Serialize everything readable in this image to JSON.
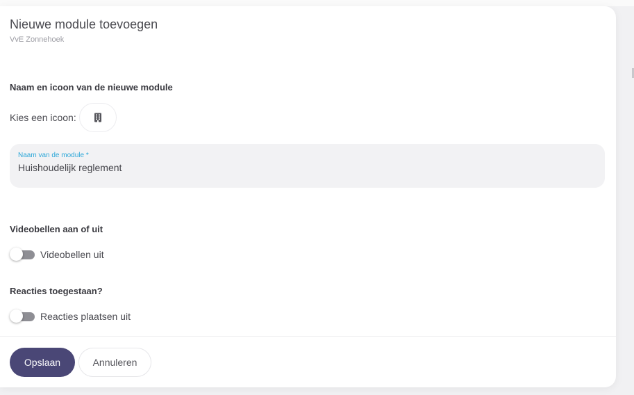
{
  "modal": {
    "title": "Nieuwe module toevoegen",
    "subtitle": "VvE Zonnehoek"
  },
  "name_section": {
    "heading": "Naam en icoon van de nieuwe module",
    "icon_label": "Kies een icoon:",
    "icon_name": "building-icon",
    "field_label": "Naam van de module *",
    "field_value": "Huishoudelijk reglement"
  },
  "video_section": {
    "heading": "Videobellen aan of uit",
    "toggle_label": "Videobellen uit",
    "toggle_on": false
  },
  "reactions_section": {
    "heading": "Reacties toegestaan?",
    "toggle_label": "Reacties plaatsen uit",
    "toggle_on": false
  },
  "footer": {
    "save_label": "Opslaan",
    "cancel_label": "Annuleren"
  },
  "colors": {
    "primary": "#4a4776",
    "field_label": "#2ca7d8",
    "toggle_track": "#8e8e94"
  }
}
